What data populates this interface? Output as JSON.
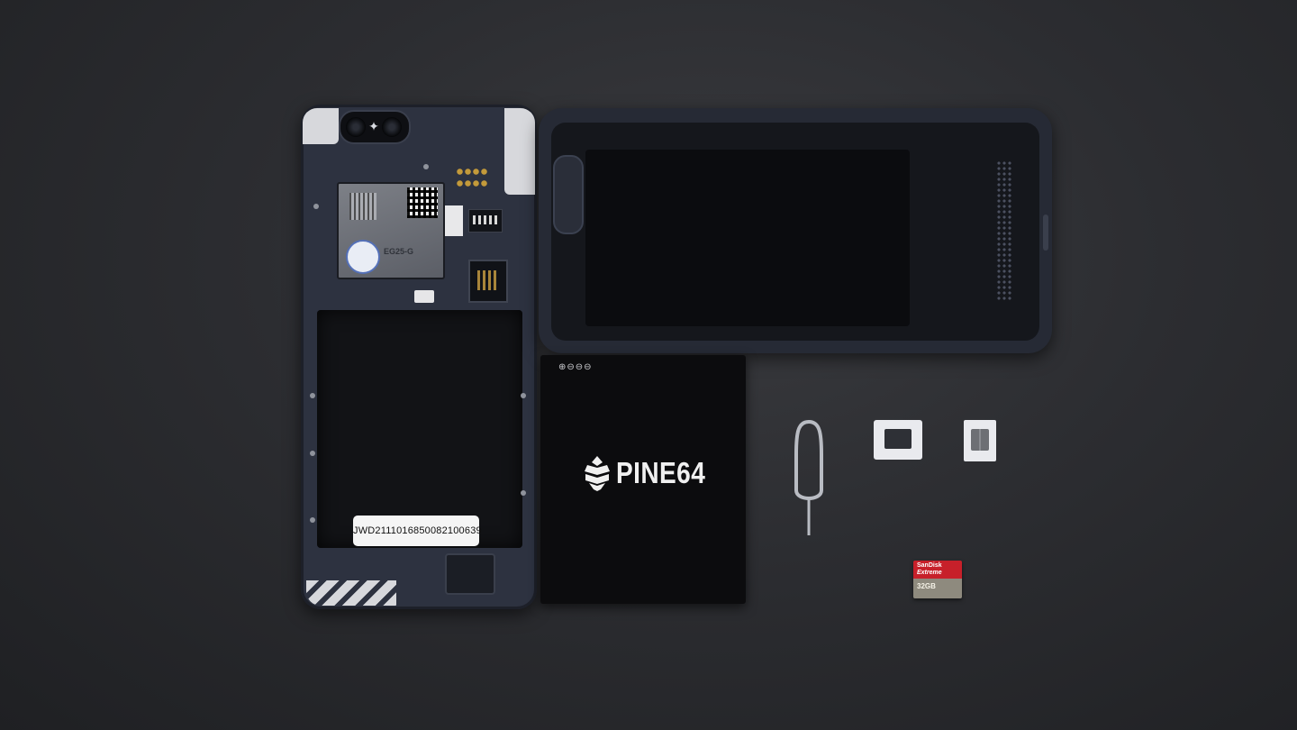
{
  "scene": {
    "description_objects": [
      "phone-body",
      "back-cover",
      "battery",
      "sim-eject-tool",
      "nano-sim-adapter",
      "nano-sim",
      "microsd-card"
    ]
  },
  "phone": {
    "serial_number": "JWD2111016850082100639",
    "modem_label": "EG25-G"
  },
  "battery": {
    "brand": "PINE64",
    "contacts_marks": "⊕⊖⊖⊖"
  },
  "microsd": {
    "brand": "SanDisk",
    "line": "Extreme",
    "capacity": "32GB"
  },
  "colors": {
    "background": "#2c2d31",
    "phone_body": "#2d3240",
    "battery": "#0c0c0e",
    "microsd_red": "#c7202a"
  }
}
